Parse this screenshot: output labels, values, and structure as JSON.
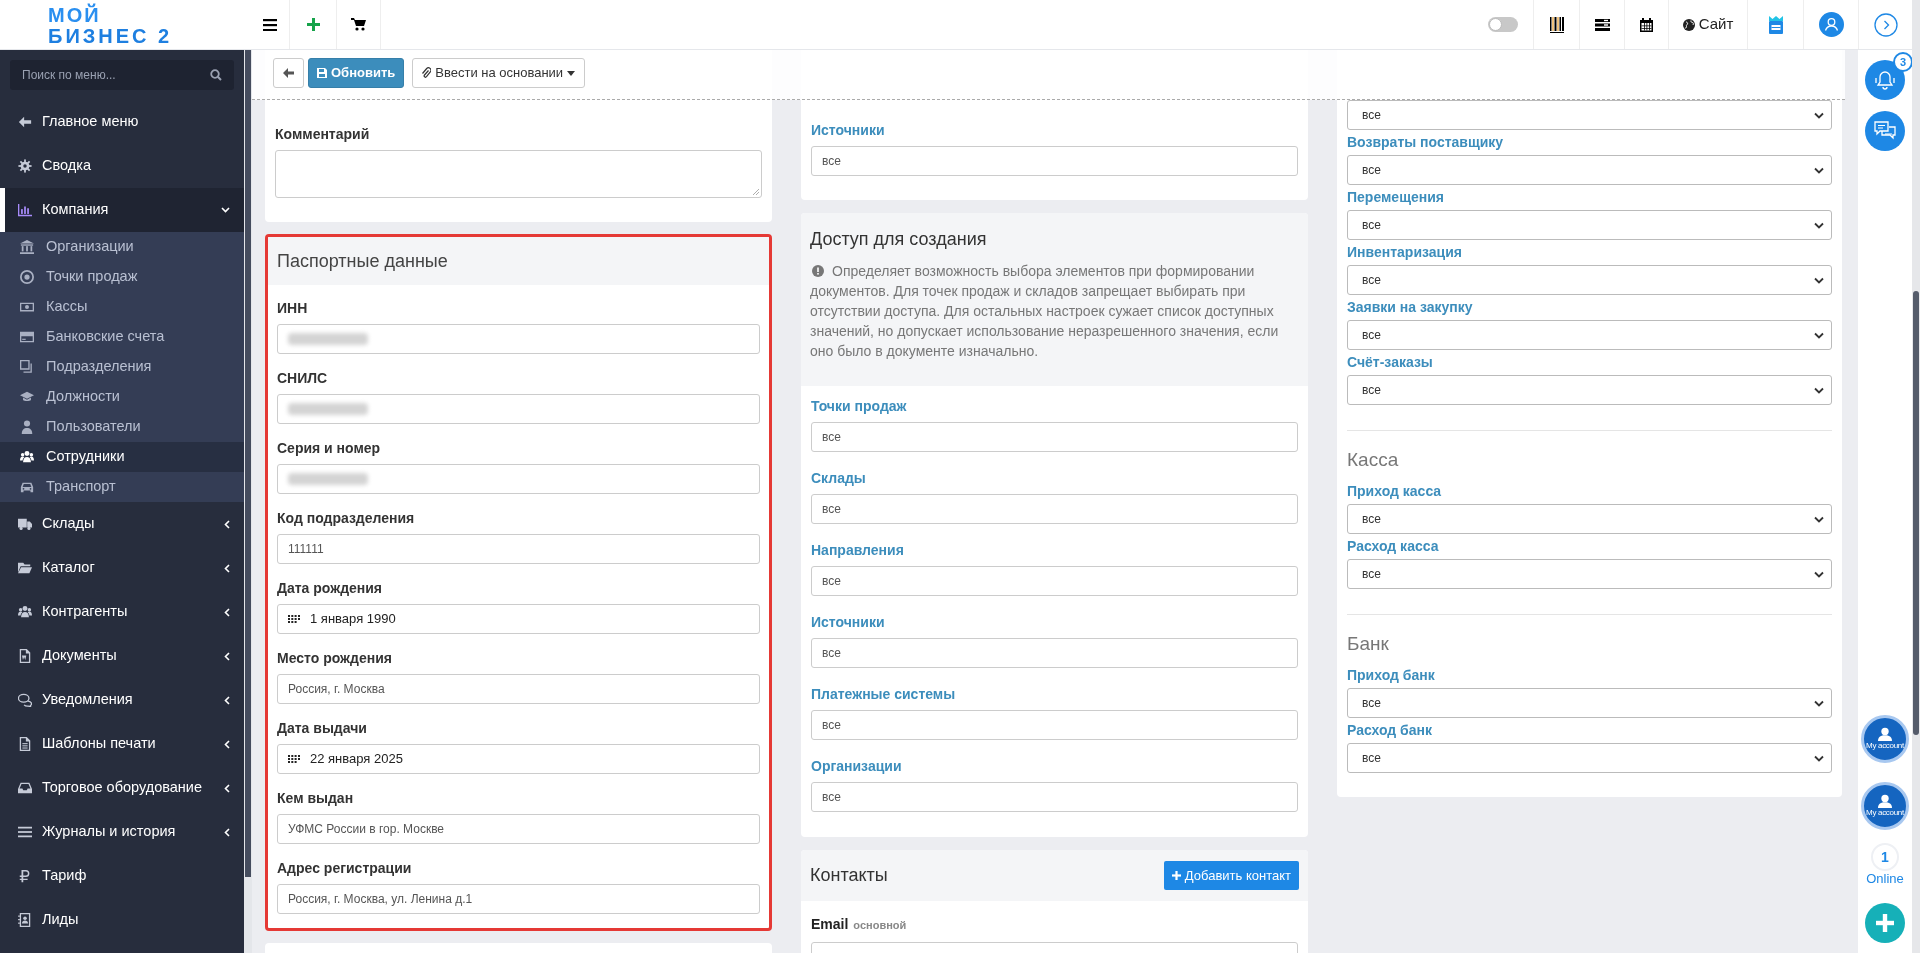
{
  "header": {
    "logo": [
      "МОЙ",
      "БИЗНЕС 2"
    ],
    "toggle": {
      "on": false
    },
    "site_link": "Сайт"
  },
  "sidebar": {
    "search_placeholder": "Поиск по меню...",
    "items": [
      {
        "label": "Главное меню",
        "selected": false
      },
      {
        "label": "Сводка",
        "selected": false
      },
      {
        "label": "Компания",
        "selected": true,
        "expanded": true,
        "children": [
          {
            "label": "Организации",
            "selected": false
          },
          {
            "label": "Точки продаж",
            "selected": false
          },
          {
            "label": "Кассы",
            "selected": false
          },
          {
            "label": "Банковские счета",
            "selected": false
          },
          {
            "label": "Подразделения",
            "selected": false
          },
          {
            "label": "Должности",
            "selected": false
          },
          {
            "label": "Пользователи",
            "selected": false
          },
          {
            "label": "Сотрудники",
            "selected": true
          },
          {
            "label": "Транспорт",
            "selected": false
          }
        ]
      },
      {
        "label": "Склады",
        "selected": false,
        "expanded": false
      },
      {
        "label": "Каталог",
        "selected": false,
        "expanded": false
      },
      {
        "label": "Контрагенты",
        "selected": false,
        "expanded": false
      },
      {
        "label": "Документы",
        "selected": false,
        "expanded": false
      },
      {
        "label": "Уведомления",
        "selected": false,
        "expanded": false
      },
      {
        "label": "Шаблоны печати",
        "selected": false,
        "expanded": false
      },
      {
        "label": "Торговое оборудование",
        "selected": false,
        "expanded": false
      },
      {
        "label": "Журналы и история",
        "selected": false,
        "expanded": false
      },
      {
        "label": "Тариф",
        "selected": false
      },
      {
        "label": "Лиды",
        "selected": false
      }
    ]
  },
  "toolbar": {
    "buttons": [
      "Обновить",
      "Ввести на основании"
    ]
  },
  "left_column": {
    "comment_label": "Комментарий",
    "passport": {
      "title": "Паспортные данные",
      "highlighted": true,
      "fields": [
        {
          "label": "ИНН",
          "kind": "blurred"
        },
        {
          "label": "СНИЛС",
          "kind": "blurred"
        },
        {
          "label": "Серия и номер",
          "kind": "blurred"
        },
        {
          "label": "Код подразделения",
          "kind": "text",
          "value": "111111"
        },
        {
          "label": "Дата рождения",
          "kind": "date",
          "value": "1 января 1990"
        },
        {
          "label": "Место рождения",
          "kind": "text",
          "value": "Россия, г. Москва"
        },
        {
          "label": "Дата выдачи",
          "kind": "date",
          "value": "22 января 2025"
        },
        {
          "label": "Кем выдан",
          "kind": "text",
          "value": "УФМС России в гор. Москве"
        },
        {
          "label": "Адрес регистрации",
          "kind": "text",
          "value": "Россия, г. Москва, ул. Ленина д.1"
        }
      ]
    }
  },
  "middle_column": {
    "top_fields": [
      {
        "label": "Источники",
        "value": "все"
      }
    ],
    "access": {
      "title": "Доступ для создания",
      "note": "Определяет возможность выбора элементов при формировании документов. Для точек продаж и складов запрещает выбирать при отсутствии доступа. Для остальных настроек сужает список доступных значений, но допускает использование неразрешенного значения, если оно было в документе изначально.",
      "fields": [
        {
          "label": "Точки продаж",
          "value": "все"
        },
        {
          "label": "Склады",
          "value": "все"
        },
        {
          "label": "Направления",
          "value": "все"
        },
        {
          "label": "Источники",
          "value": "все"
        },
        {
          "label": "Платежные системы",
          "value": "все"
        },
        {
          "label": "Организации",
          "value": "все"
        }
      ]
    },
    "contacts": {
      "title": "Контакты",
      "add_button": "Добавить контакт",
      "email_label": "Email",
      "email_hint": "основной"
    }
  },
  "right_column": {
    "fields": [
      {
        "value": "все"
      },
      {
        "label": "Возвраты поставщику",
        "value": "все"
      },
      {
        "label": "Перемещения",
        "value": "все"
      },
      {
        "label": "Инвентаризация",
        "value": "все"
      },
      {
        "label": "Заявки на закупку",
        "value": "все"
      },
      {
        "label": "Счёт-заказы",
        "value": "все"
      }
    ],
    "sections": [
      {
        "title": "Касса",
        "fields": [
          {
            "label": "Приход касса",
            "value": "все"
          },
          {
            "label": "Расход касса",
            "value": "все"
          }
        ]
      },
      {
        "title": "Банк",
        "fields": [
          {
            "label": "Приход банк",
            "value": "все"
          },
          {
            "label": "Расход банк",
            "value": "все"
          }
        ]
      }
    ]
  },
  "rail": {
    "notification_count": "3",
    "account_labels": [
      "My account",
      "My account"
    ],
    "online_count": "1",
    "online_label": "Online"
  }
}
